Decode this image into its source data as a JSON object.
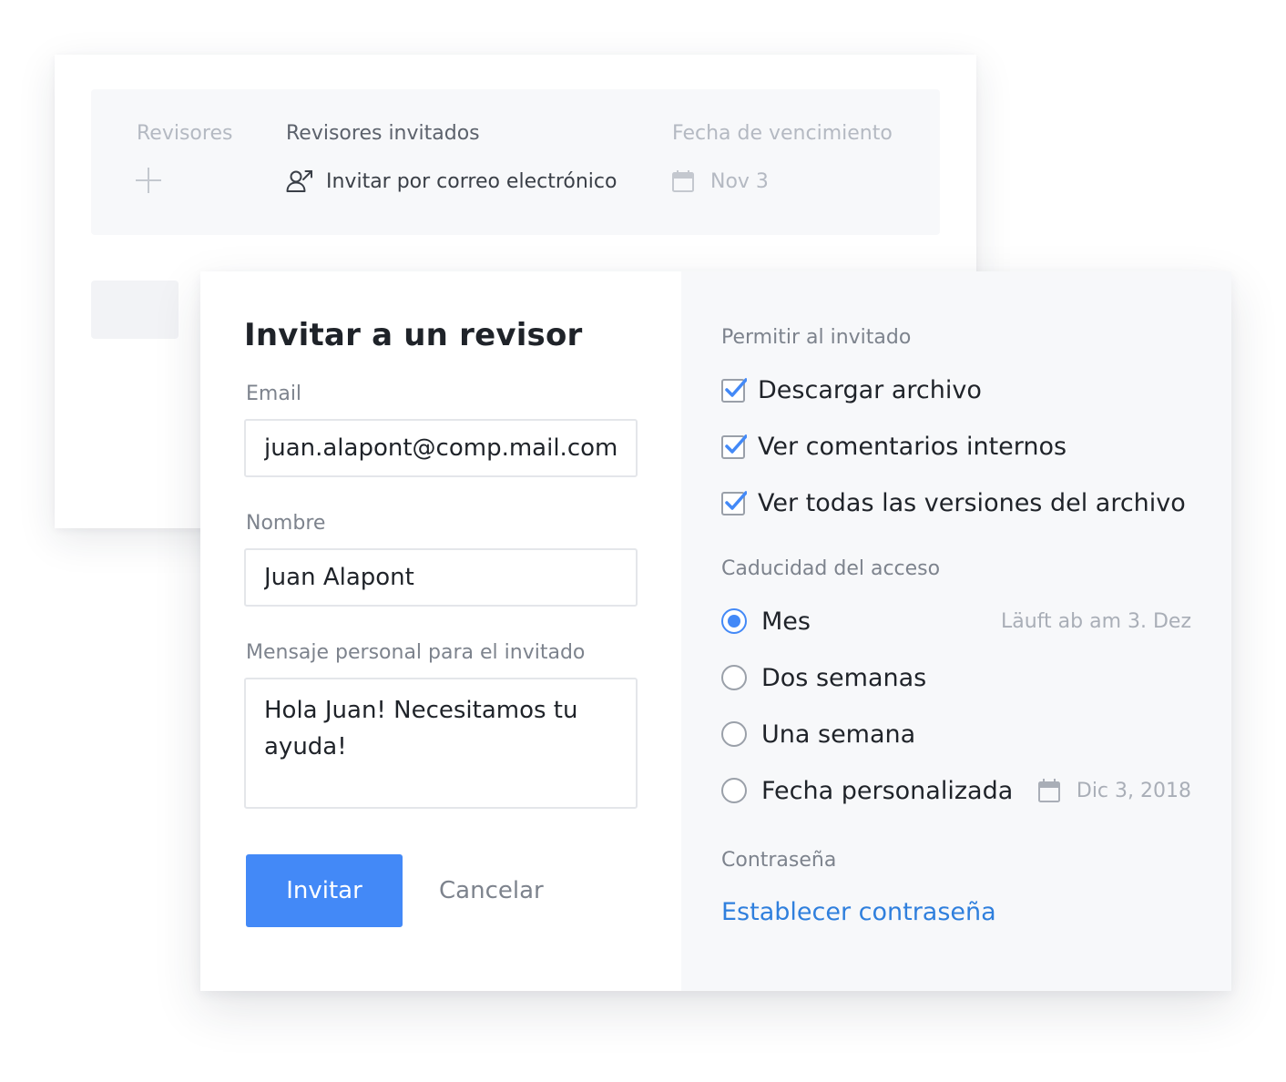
{
  "background": {
    "columns": {
      "reviewers_label": "Revisores",
      "invited_label": "Revisores invitados",
      "due_label": "Fecha de vencimiento"
    },
    "invite_by_email": "Invitar por correo electrónico",
    "due_date": "Nov 3"
  },
  "dialog": {
    "title": "Invitar a un revisor",
    "email": {
      "label": "Email",
      "value": "juan.alapont@comp.mail.com"
    },
    "name": {
      "label": "Nombre",
      "value": "Juan Alapont"
    },
    "message": {
      "label": "Mensaje personal para el invitado",
      "value": "Hola Juan! Necesitamos tu ayuda!"
    },
    "invite_button": "Invitar",
    "cancel_button": "Cancelar"
  },
  "permissions": {
    "label": "Permitir al invitado",
    "items": [
      {
        "label": "Descargar archivo",
        "checked": true
      },
      {
        "label": "Ver comentarios internos",
        "checked": true
      },
      {
        "label": "Ver todas las versiones del archivo",
        "checked": true
      }
    ]
  },
  "expiry": {
    "label": "Caducidad del acceso",
    "options": [
      {
        "label": "Mes",
        "selected": true
      },
      {
        "label": "Dos semanas",
        "selected": false
      },
      {
        "label": "Una semana",
        "selected": false
      },
      {
        "label": "Fecha personalizada",
        "selected": false
      }
    ],
    "expires_note": "Läuft ab am 3. Dez",
    "custom_date": "Dic 3, 2018"
  },
  "password": {
    "label": "Contraseña",
    "link": "Establecer contraseña"
  },
  "colors": {
    "accent": "#4389f7",
    "link": "#2f7fdd",
    "panel_bg": "#f7f8fa"
  }
}
